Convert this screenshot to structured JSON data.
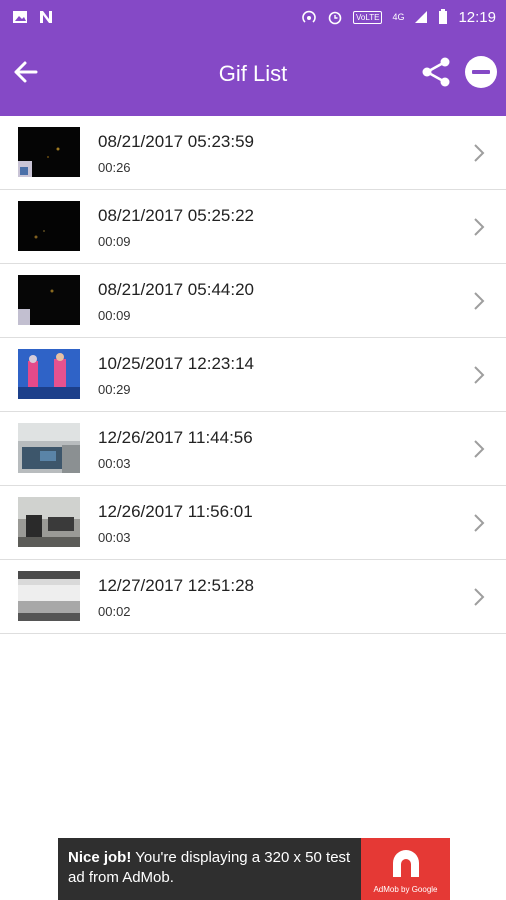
{
  "statusbar": {
    "lte_badge": "VoLTE",
    "network": "4G",
    "time": "12:19"
  },
  "toolbar": {
    "title": "Gif List"
  },
  "items": [
    {
      "date": "08/21/2017 05:23:59",
      "duration": "00:26"
    },
    {
      "date": "08/21/2017 05:25:22",
      "duration": "00:09"
    },
    {
      "date": "08/21/2017 05:44:20",
      "duration": "00:09"
    },
    {
      "date": "10/25/2017 12:23:14",
      "duration": "00:29"
    },
    {
      "date": "12/26/2017 11:44:56",
      "duration": "00:03"
    },
    {
      "date": "12/26/2017 11:56:01",
      "duration": "00:03"
    },
    {
      "date": "12/27/2017 12:51:28",
      "duration": "00:02"
    }
  ],
  "ad": {
    "bold": "Nice job!",
    "text": " You're displaying a 320 x 50 test ad from AdMob.",
    "brand": "AdMob by Google"
  },
  "colors": {
    "appbar": "#8549c6",
    "ad_bg": "#2f2f2f",
    "ad_logo": "#e53935"
  }
}
